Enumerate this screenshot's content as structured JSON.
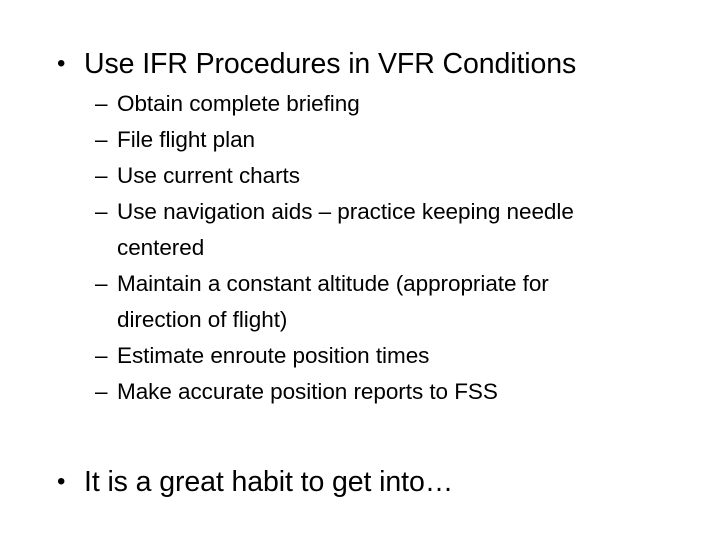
{
  "slide": {
    "background_color": "#ffffff",
    "text_color": "#000000",
    "bullet_glyph": "•",
    "dash_glyph": "–",
    "heading": "Use IFR Procedures in VFR Conditions",
    "sub_items": [
      "Obtain complete briefing",
      "File flight plan",
      "Use current charts",
      "Use navigation aids – practice keeping needle centered",
      "Maintain a constant altitude (appropriate for direction of flight)",
      "Estimate enroute position times",
      "Make accurate position reports to FSS"
    ],
    "closing": "It is a great habit to get into…"
  }
}
